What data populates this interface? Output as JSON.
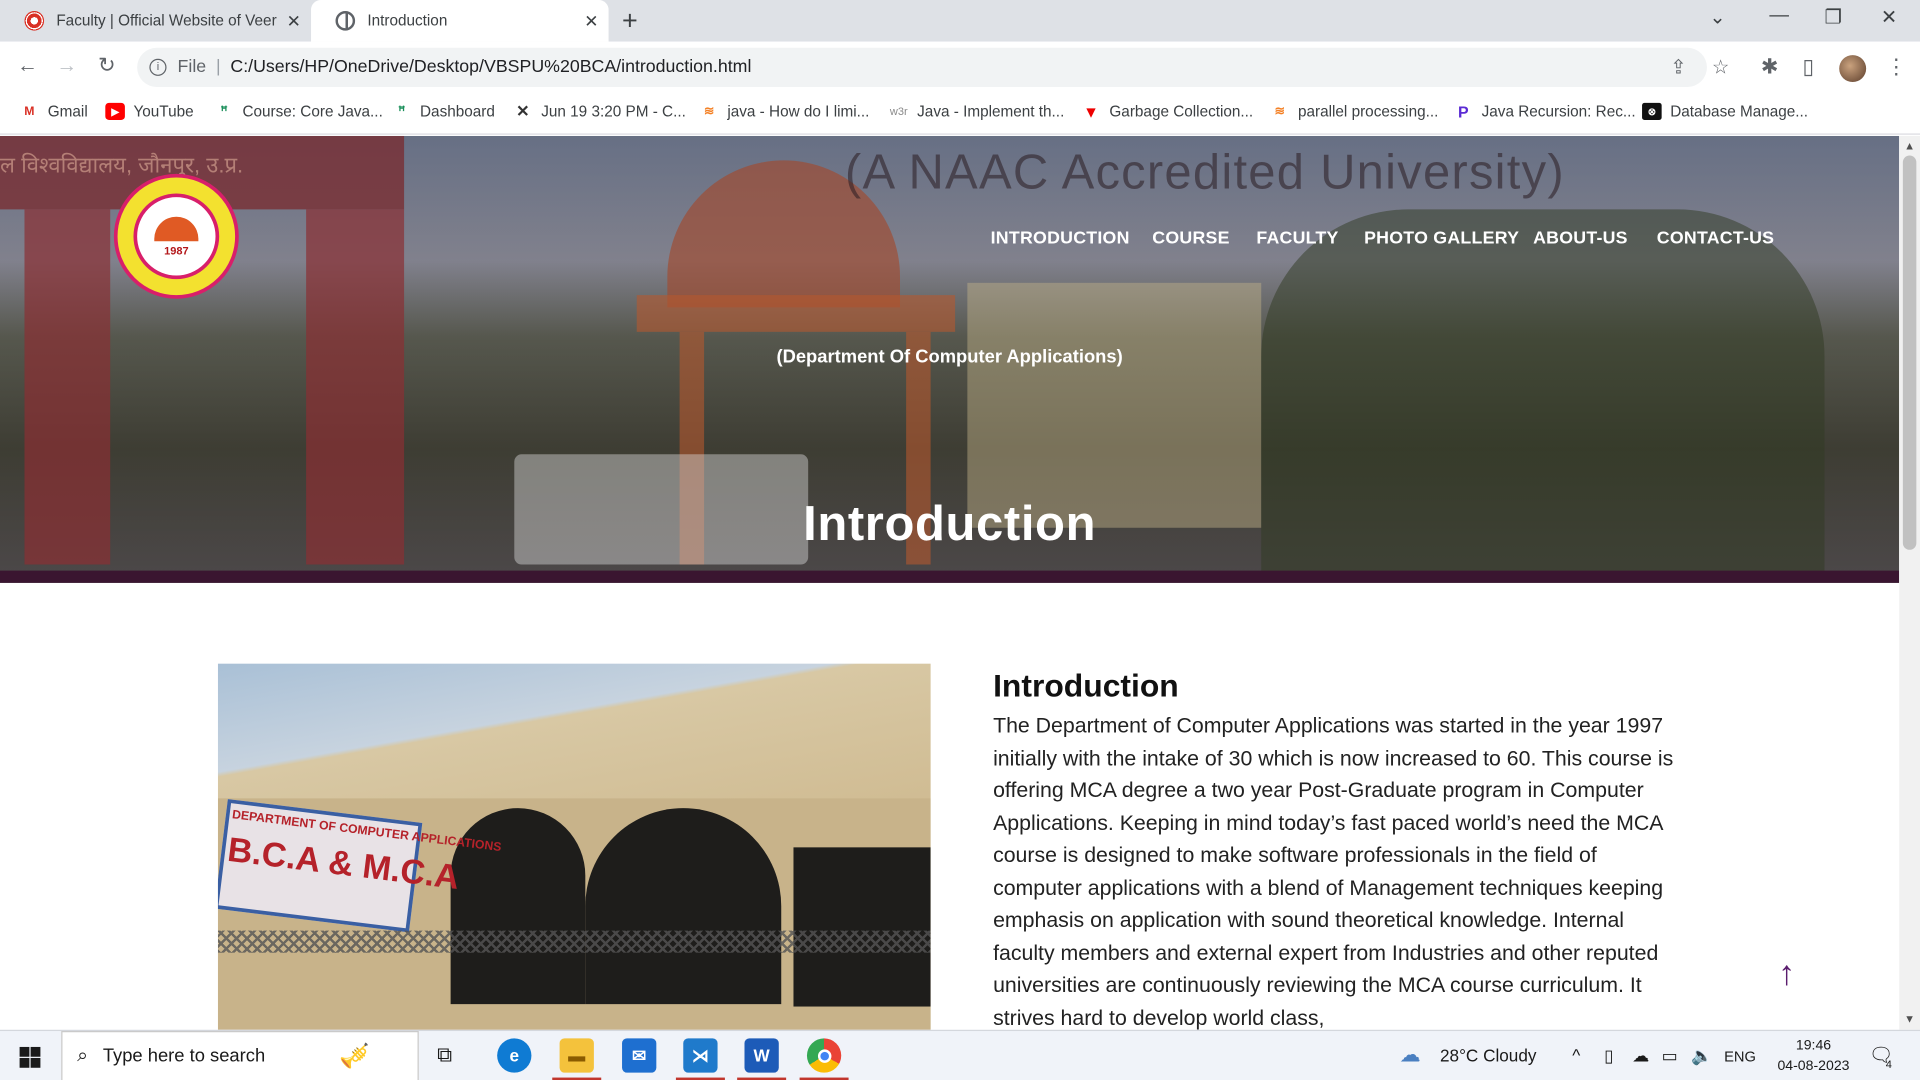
{
  "browser": {
    "tabs": [
      {
        "title": "Faculty | Official Website of Veer",
        "active": false
      },
      {
        "title": "Introduction",
        "active": true
      }
    ],
    "address": {
      "scheme_label": "File",
      "url": "C:/Users/HP/OneDrive/Desktop/VBSPU%20BCA/introduction.html"
    },
    "bookmarks": [
      {
        "label": "Gmail",
        "icon": "gmail-icon"
      },
      {
        "label": "YouTube",
        "icon": "youtube-icon"
      },
      {
        "label": "Course: Core Java...",
        "icon": "course-icon"
      },
      {
        "label": "Dashboard",
        "icon": "dashboard-icon"
      },
      {
        "label": "Jun 19 3:20 PM - C...",
        "icon": "meeting-icon"
      },
      {
        "label": "java - How do I limi...",
        "icon": "stackoverflow-icon"
      },
      {
        "label": "Java - Implement th...",
        "icon": "w3r-icon",
        "icon_text": "w3r"
      },
      {
        "label": "Garbage Collection...",
        "icon": "triangle-icon"
      },
      {
        "label": "parallel processing...",
        "icon": "stackoverflow-icon"
      },
      {
        "label": "Java Recursion: Rec...",
        "icon": "p-icon"
      },
      {
        "label": "Database Manage...",
        "icon": "database-icon"
      }
    ]
  },
  "site": {
    "banner_text": "(A NAAC Accredited University)",
    "logo_year": "1987",
    "menu": [
      "INTRODUCTION",
      "COURSE",
      "FACULTY",
      "PHOTO GALLERY",
      "ABOUT-US",
      "CONTACT-US"
    ],
    "department": "(Department Of Computer Applications)",
    "hero_title": "Introduction",
    "section_heading": "Introduction",
    "photo_sign_line1": "DEPARTMENT OF COMPUTER APPLICATIONS",
    "photo_sign_line2": "B.C.A & M.C.A",
    "paragraph": "The Department of Computer Applications was started in the year 1997 initially with the intake of 30 which is now increased to 60. This course is offering MCA degree a two year Post-Graduate program in Computer Applications. Keeping in mind today’s fast paced world’s need the MCA course is designed to make software professionals in the field of computer applications with a blend of Management techniques keeping emphasis on application with sound theoretical knowledge. Internal faculty members and external expert from Industries and other reputed universities are continuously reviewing the MCA course curriculum. It strives hard to develop world class,"
  },
  "taskbar": {
    "search_placeholder": "Type here to search",
    "weather": "28°C  Cloudy",
    "language": "ENG",
    "time": "19:46",
    "date": "04-08-2023",
    "notification_count": "4"
  },
  "colors": {
    "accent": "#5b1d6e",
    "hero_bottom": "#3a1530",
    "logo_ring": "#d81f6a"
  }
}
